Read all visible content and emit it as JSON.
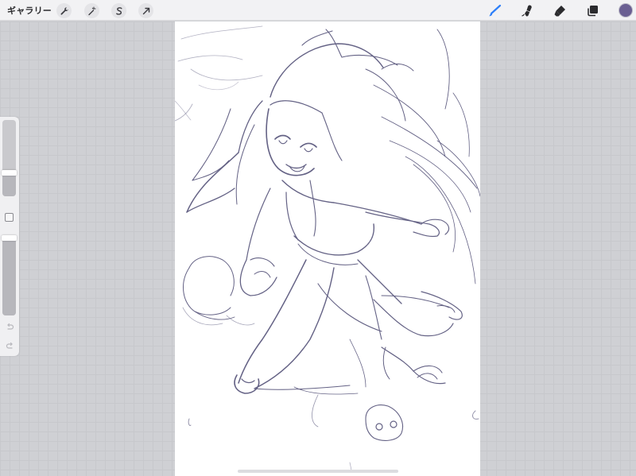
{
  "toolbar": {
    "gallery_label": "ギャラリー",
    "left_tools": [
      {
        "icon": "wrench-icon"
      },
      {
        "icon": "magic-wand-icon"
      },
      {
        "icon": "selection-s-icon"
      },
      {
        "icon": "move-arrow-icon"
      }
    ],
    "right_tools": [
      {
        "icon": "brush-icon",
        "active": true
      },
      {
        "icon": "smudge-icon"
      },
      {
        "icon": "eraser-icon"
      },
      {
        "icon": "layers-icon"
      }
    ],
    "current_color": "#6a5f92"
  },
  "sidebar": {
    "brush_size_level": 0.31,
    "opacity_level": 1.0,
    "undo_icon": "undo-arrow-icon",
    "redo_icon": "redo-arrow-icon"
  },
  "colors": {
    "accent": "#2d7ff9",
    "sketch_stroke": "#4a4770"
  }
}
